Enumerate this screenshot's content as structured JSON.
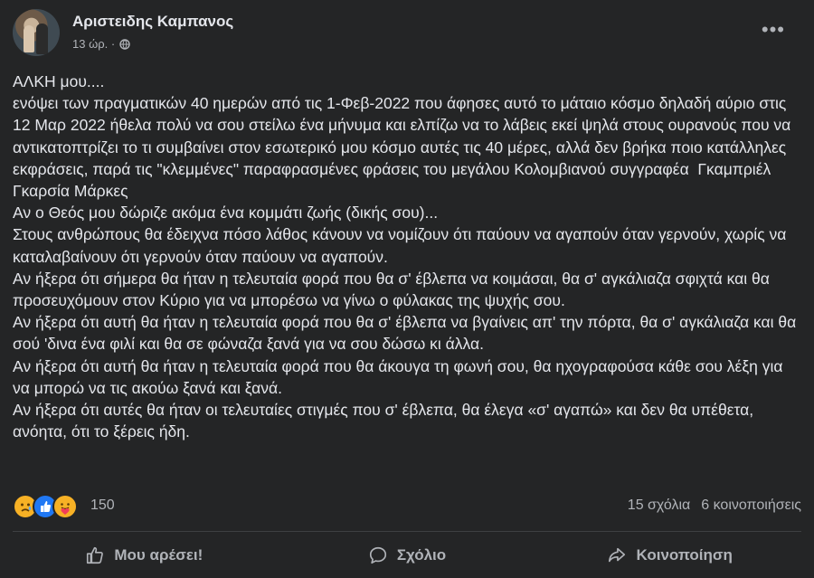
{
  "post": {
    "author": "Αριστειδης Καμπανος",
    "time": "13 ώρ. ·",
    "privacy_icon": "globe-icon",
    "more_icon": "more-options-icon",
    "paragraphs": [
      "ΑΛΚΗ μου....",
      "ενόψει των πραγματικών 40 ημερών από τις 1-Φεβ-2022 που άφησες αυτό το μάταιο κόσμο δηλαδή αύριο στις 12 Μαρ 2022 ήθελα πολύ να σου στείλω ένα μήνυμα και ελπίζω να το λάβεις εκεί ψηλά στους ουρανούς που να αντικατοπτρίζει το τι συμβαίνει στον εσωτερικό μου κόσμο αυτές τις 40 μέρες, αλλά δεν βρήκα ποιο κατάλληλες εκφράσεις, παρά τις \"κλεμμένες\" παραφρασμένες φράσεις του μεγάλου Κολομβιανού συγγραφέα  Γκαμπριέλ Γκαρσία Μάρκες",
      "Αν ο Θεός μου δώριζε ακόμα ένα κομμάτι ζωής (δικής σου)...",
      "Στους ανθρώπους θα έδειχνα πόσο λάθος κάνουν να νομίζουν ότι παύουν να αγαπούν όταν γερνούν, χωρίς να καταλαβαίνουν ότι γερνούν όταν παύουν να αγαπούν.",
      "Αν ήξερα ότι σήμερα θα ήταν η τελευταία φορά που θα σ' έβλεπα να κοιμάσαι, θα σ' αγκάλιαζα σφιχτά και θα προσευχόμουν στον Κύριο για να μπορέσω να γίνω ο φύλακας της ψυχής σου.",
      "Αν ήξερα ότι αυτή θα ήταν η τελευταία φορά που θα σ' έβλεπα να βγαίνεις απ' την πόρτα, θα σ' αγκάλιαζα και θα σού 'δινα ένα φιλί και θα σε φώναζα ξανά για να σου δώσω κι άλλα.",
      "Αν ήξερα ότι αυτή θα ήταν η τελευταία φορά που θα άκουγα τη φωνή σου, θα ηχογραφούσα κάθε σου λέξη για να μπορώ να τις ακούω ξανά και ξανά.",
      "Αν ήξερα ότι αυτές θα ήταν οι τελευταίες στιγμές που σ' έβλεπα, θα έλεγα «σ' αγαπώ» και δεν θα υπέθετα, ανόητα, ότι το ξέρεις ήδη."
    ]
  },
  "reactions": {
    "icons": [
      "sad-reaction-icon",
      "like-reaction-icon",
      "care-reaction-icon"
    ],
    "count": "150",
    "comments": "15 σχόλια",
    "shares": "6 κοινοποιήσεις"
  },
  "actions": {
    "like": "Μου αρέσει!",
    "comment": "Σχόλιο",
    "share": "Κοινοποίηση"
  },
  "colors": {
    "background": "#242526",
    "text": "#e4e6eb",
    "secondary": "#b0b3b8",
    "like_blue": "#2078f4"
  }
}
